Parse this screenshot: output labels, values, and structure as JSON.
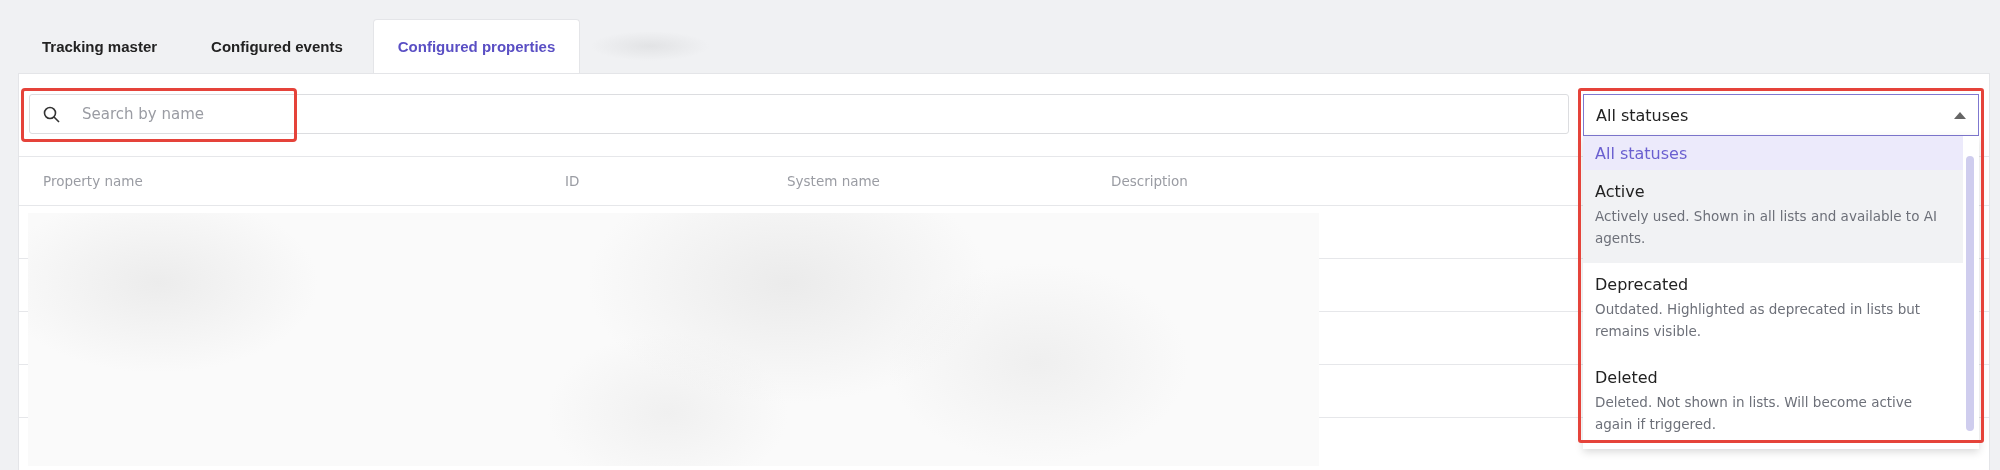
{
  "tabs": [
    {
      "label": "Tracking master",
      "selected": false
    },
    {
      "label": "Configured events",
      "selected": false
    },
    {
      "label": "Configured properties",
      "selected": true
    },
    {
      "kind": "blurred"
    }
  ],
  "search": {
    "placeholder": "Search by name",
    "highlighted": true
  },
  "status_filter": {
    "value": "All statuses",
    "expanded": true,
    "highlighted": true,
    "options": [
      {
        "label": "All statuses",
        "selected": true,
        "hovered": false
      },
      {
        "label": "Active",
        "description": "Actively used. Shown in all lists and available to AI agents.",
        "selected": false,
        "hovered": true
      },
      {
        "label": "Deprecated",
        "description": "Outdated. Highlighted as deprecated in lists but remains visible.",
        "selected": false,
        "hovered": false
      },
      {
        "label": "Deleted",
        "description": "Deleted. Not shown in lists. Will become active again if triggered.",
        "selected": false,
        "hovered": false
      }
    ]
  },
  "table": {
    "columns": [
      "Property name",
      "ID",
      "System name",
      "Description"
    ]
  }
}
